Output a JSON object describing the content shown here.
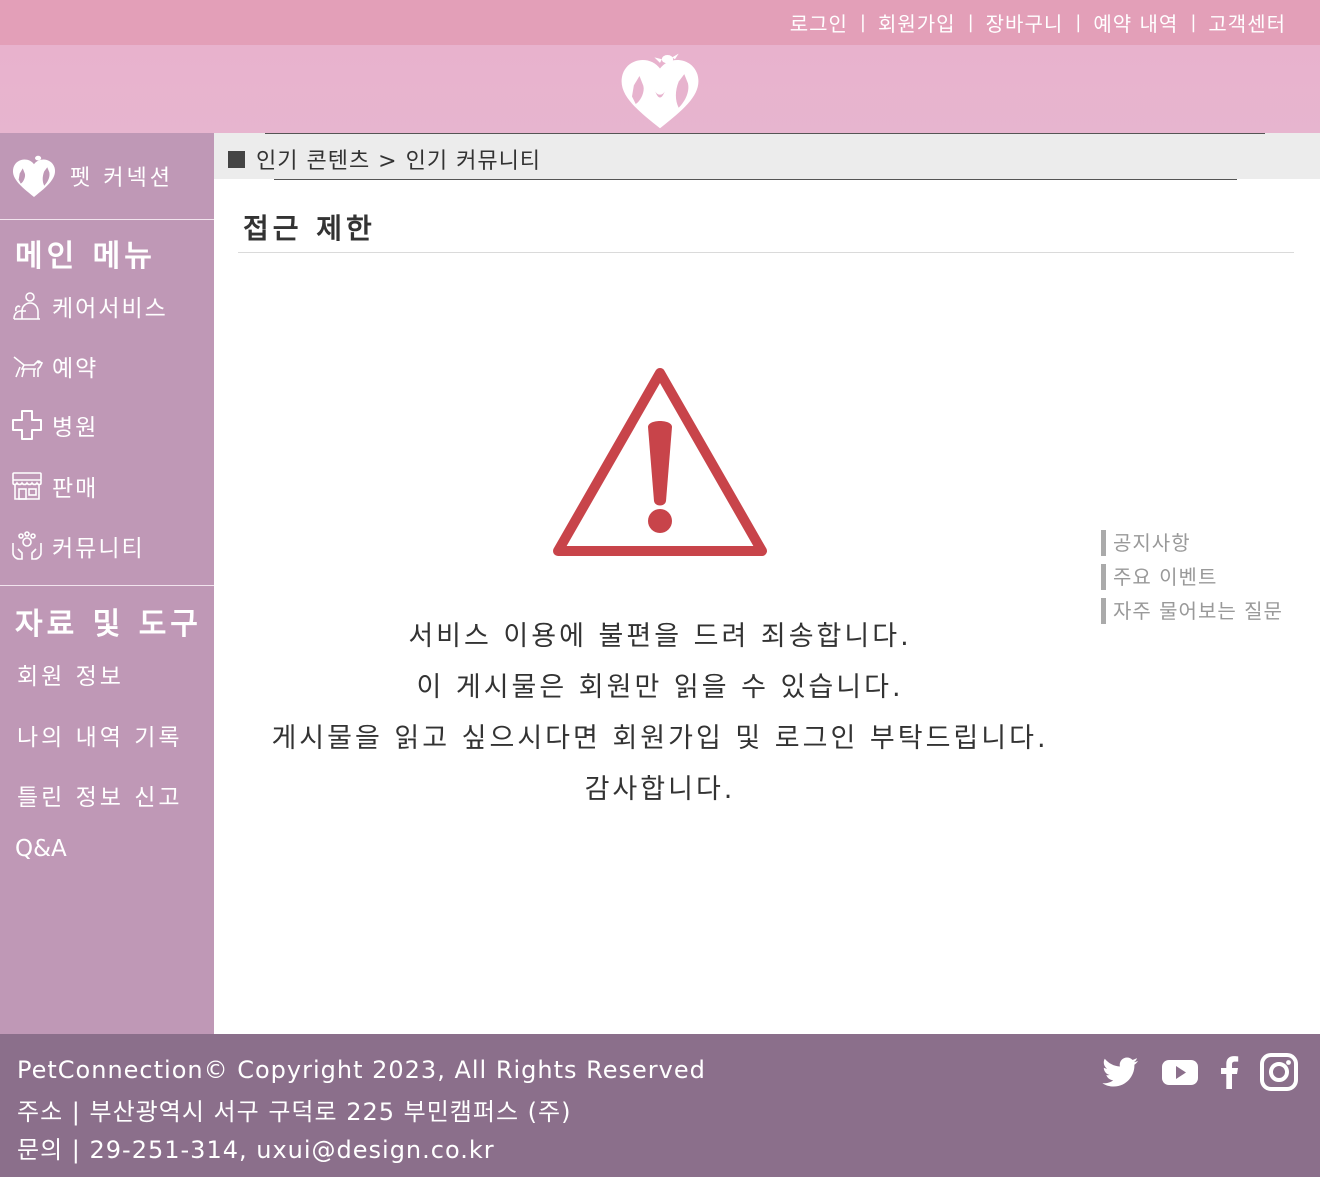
{
  "top_nav": {
    "items": [
      "로그인",
      "회원가입",
      "장바구니",
      "예약 내역",
      "고객센터"
    ],
    "separator": "|"
  },
  "sidebar": {
    "brand_name": "펫 커넥션",
    "main_menu_title": "메인 메뉴",
    "main_menu": [
      {
        "label": "케어서비스",
        "icon": "pet-care-icon"
      },
      {
        "label": "예약",
        "icon": "dog-icon"
      },
      {
        "label": "병원",
        "icon": "medical-cross-icon"
      },
      {
        "label": "판매",
        "icon": "store-icon"
      },
      {
        "label": "커뮤니티",
        "icon": "community-hands-icon"
      }
    ],
    "tools_title": "자료 및 도구",
    "tools": [
      "회원 정보",
      "나의 내역 기록",
      "틀린 정보 신고",
      "Q&A"
    ]
  },
  "breadcrumb": "인기 콘텐츠 > 인기 커뮤니티",
  "page_title": "접근 제한",
  "message_lines": [
    "서비스 이용에 불편을 드려 죄송합니다.",
    "이 게시물은 회원만 읽을 수 있습니다.",
    "게시물을 읽고 싶으시다면 회원가입 및 로그인 부탁드립니다.",
    "감사합니다."
  ],
  "side_links": [
    "공지사항",
    "주요 이벤트",
    "자주 물어보는 질문"
  ],
  "footer": {
    "copyright": "PetConnection© Copyright 2023, All Rights Reserved",
    "address": "주소 | 부산광역시 서구 구덕로 225 부민캠퍼스 (주)",
    "contact": "문의 | 29-251-314, uxui@design.co.kr",
    "social": [
      "twitter-icon",
      "youtube-icon",
      "facebook-icon",
      "instagram-icon"
    ]
  },
  "colors": {
    "top_bar": "#e39fb8",
    "banner": "#e8b2cd",
    "sidebar": "#bf98b6",
    "footer": "#8b6f8b",
    "warning_red": "#c8444a"
  }
}
